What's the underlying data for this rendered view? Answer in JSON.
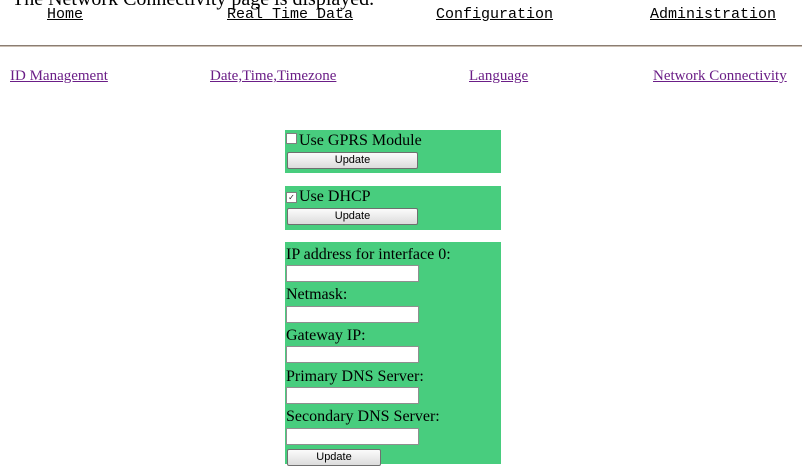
{
  "top_heading": "The Network Connectivity page is displayed.",
  "main_nav": {
    "home": "Home",
    "real_time_data": "Real Time Data",
    "configuration": "Configuration",
    "administration": "Administration"
  },
  "sub_nav": {
    "id_management": "ID Management",
    "date_time": "Date,Time,Timezone",
    "language": "Language",
    "network": "Network Connectivity"
  },
  "gprs": {
    "label": "Use GPRS Module",
    "checked": false,
    "update_label": "Update"
  },
  "dhcp": {
    "label": "Use DHCP",
    "checked": true,
    "check_glyph": "✓",
    "update_label": "Update"
  },
  "ip_settings": {
    "ip_label": "IP address for interface 0:",
    "ip_value": "",
    "netmask_label": "Netmask:",
    "netmask_value": "",
    "gateway_label": "Gateway IP:",
    "gateway_value": "",
    "primary_dns_label": "Primary DNS Server:",
    "primary_dns_value": "",
    "secondary_dns_label": "Secondary DNS Server:",
    "secondary_dns_value": "",
    "update_label": "Update"
  },
  "colors": {
    "panel": "#48cd7e",
    "link_visited": "#6b1e87"
  }
}
